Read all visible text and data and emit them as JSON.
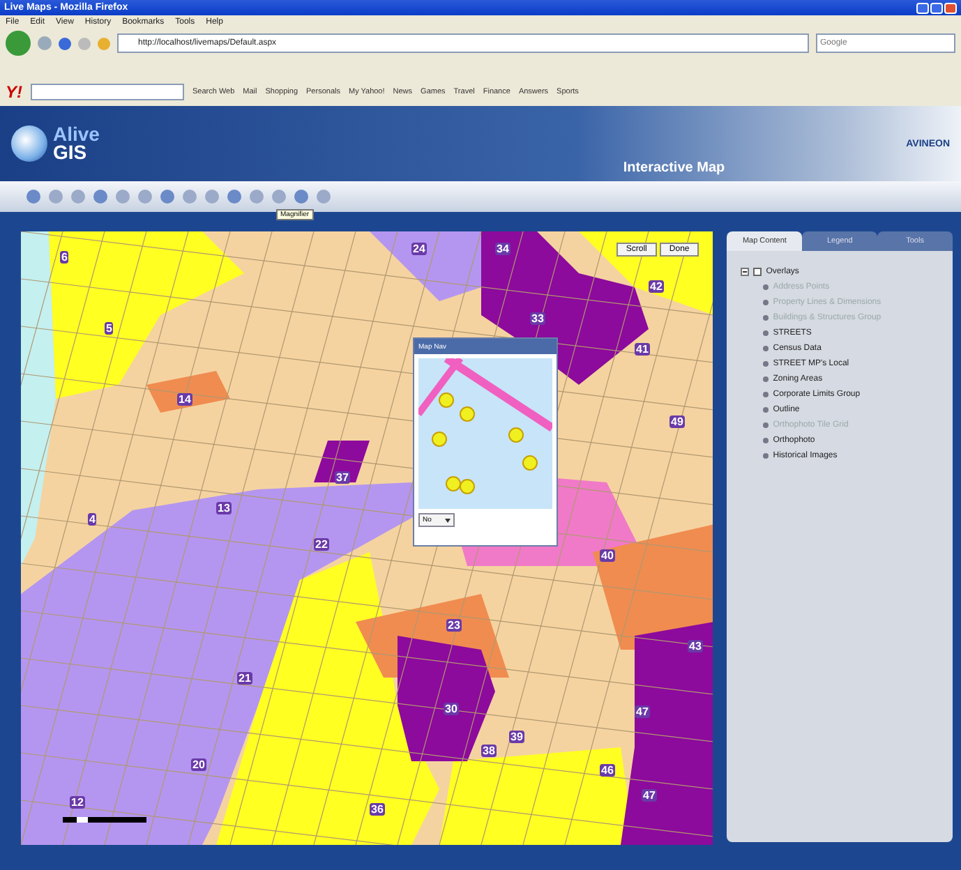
{
  "window": {
    "title": "Live Maps - Mozilla Firefox"
  },
  "menu": [
    "File",
    "Edit",
    "View",
    "History",
    "Bookmarks",
    "Tools",
    "Help"
  ],
  "address": {
    "value": "http://localhost/livemaps/Default.aspx"
  },
  "search": {
    "placeholder": "Google"
  },
  "yahoo_logo": "Y!",
  "yahoo_toolbar": [
    "Search Web",
    "Mail",
    "Shopping",
    "Personals",
    "My Yahoo!",
    "News",
    "Games",
    "Travel",
    "Finance",
    "Answers",
    "Sports"
  ],
  "banner": {
    "logo_top": "Alive",
    "logo_bottom": "GIS",
    "title": "Interactive Map",
    "company": "AVINEON"
  },
  "toolbar": {
    "tooltip": "Magnifier"
  },
  "map": {
    "buttons": [
      "Scroll",
      "Done"
    ],
    "labels": [
      "6",
      "24",
      "34",
      "42",
      "33",
      "5",
      "41",
      "14",
      "49",
      "37",
      "4",
      "13",
      "22",
      "40",
      "23",
      "21",
      "43",
      "30",
      "39",
      "38",
      "20",
      "46",
      "47",
      "12",
      "36",
      "47"
    ]
  },
  "overview": {
    "title": "Map Nav",
    "select": "No"
  },
  "panel": {
    "tabs": [
      {
        "label": "Map Content",
        "selected": true
      },
      {
        "label": "Legend",
        "selected": false
      },
      {
        "label": "Tools",
        "selected": false
      }
    ],
    "root": {
      "label": "Overlays",
      "checked": false,
      "expanded": true,
      "children": [
        {
          "label": "Address Points",
          "enabled": false
        },
        {
          "label": "Property Lines & Dimensions",
          "enabled": false
        },
        {
          "label": "Buildings & Structures Group",
          "enabled": false
        },
        {
          "label": "STREETS",
          "enabled": true
        },
        {
          "label": "Census Data",
          "enabled": true
        },
        {
          "label": "STREET MP's Local",
          "enabled": true
        },
        {
          "label": "Zoning Areas",
          "enabled": true
        },
        {
          "label": "Corporate Limits Group",
          "enabled": true
        },
        {
          "label": "Outline",
          "enabled": true
        },
        {
          "label": "Orthophoto Tile Grid",
          "enabled": false
        },
        {
          "label": "Orthophoto",
          "enabled": true
        },
        {
          "label": "Historical Images",
          "enabled": true
        }
      ]
    }
  }
}
